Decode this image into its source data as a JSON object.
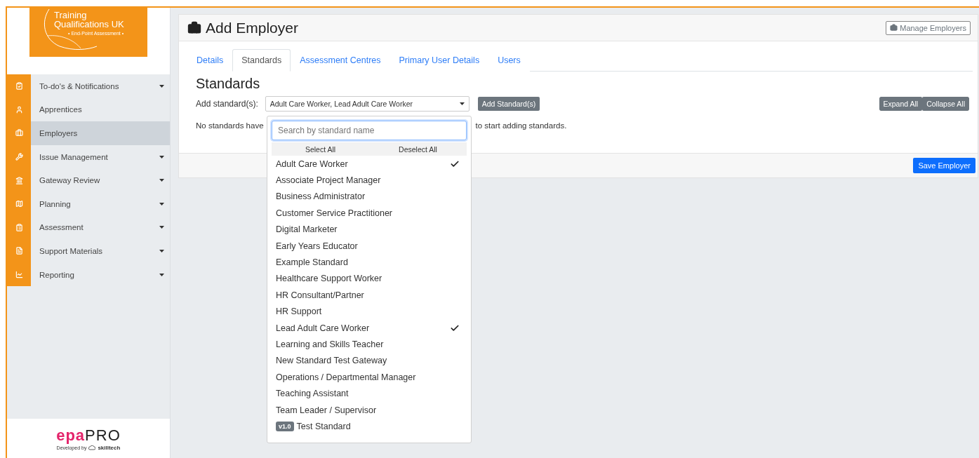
{
  "sidebar": {
    "logo": {
      "line_1": "Training",
      "line_2": "Qualifications UK",
      "tagline": "• End-Point Assessment •"
    },
    "items": [
      {
        "label": "To-do's & Notifications",
        "expandable": true,
        "selected": false
      },
      {
        "label": "Apprentices",
        "expandable": false,
        "selected": false
      },
      {
        "label": "Employers",
        "expandable": false,
        "selected": true
      },
      {
        "label": "Issue Management",
        "expandable": true,
        "selected": false
      },
      {
        "label": "Gateway Review",
        "expandable": true,
        "selected": false
      },
      {
        "label": "Planning",
        "expandable": true,
        "selected": false
      },
      {
        "label": "Assessment",
        "expandable": true,
        "selected": false
      },
      {
        "label": "Support Materials",
        "expandable": true,
        "selected": false
      },
      {
        "label": "Reporting",
        "expandable": true,
        "selected": false
      }
    ],
    "footer": {
      "brand_1": "epa",
      "brand_2": "PRO",
      "developed_by": "Developed by",
      "developer": "skilltech"
    }
  },
  "page": {
    "title": "Add Employer",
    "manage_button": "Manage Employers"
  },
  "tabs": [
    {
      "label": "Details",
      "selected": false
    },
    {
      "label": "Standards",
      "selected": true
    },
    {
      "label": "Assessment Centres",
      "selected": false
    },
    {
      "label": "Primary User Details",
      "selected": false
    },
    {
      "label": "Users",
      "selected": false
    }
  ],
  "section": {
    "title": "Standards",
    "add_label": "Add standard(s):",
    "select_value": "Adult Care Worker, Lead Adult Care Worker",
    "add_button": "Add Standard(s)",
    "expand_button": "Expand All",
    "collapse_button": "Collapse All",
    "empty_message_start": "No standards have",
    "empty_message_end": "to start adding standards."
  },
  "dropdown": {
    "search_placeholder": "Search by standard name",
    "select_all": "Select All",
    "deselect_all": "Deselect All",
    "options": [
      {
        "label": "Adult Care Worker",
        "checked": true
      },
      {
        "label": "Associate Project Manager",
        "checked": false
      },
      {
        "label": "Business Administrator",
        "checked": false
      },
      {
        "label": "Customer Service Practitioner",
        "checked": false
      },
      {
        "label": "Digital Marketer",
        "checked": false
      },
      {
        "label": "Early Years Educator",
        "checked": false
      },
      {
        "label": "Example Standard",
        "checked": false
      },
      {
        "label": "Healthcare Support Worker",
        "checked": false
      },
      {
        "label": "HR Consultant/Partner",
        "checked": false
      },
      {
        "label": "HR Support",
        "checked": false
      },
      {
        "label": "Lead Adult Care Worker",
        "checked": true
      },
      {
        "label": "Learning and Skills Teacher",
        "checked": false
      },
      {
        "label": "New Standard Test Gateway",
        "checked": false
      },
      {
        "label": "Operations / Departmental Manager",
        "checked": false
      },
      {
        "label": "Teaching Assistant",
        "checked": false
      },
      {
        "label": "Team Leader / Supervisor",
        "checked": false
      },
      {
        "label": "Test Standard",
        "checked": false,
        "badge": "v1.0"
      }
    ]
  },
  "save_button": "Save Employer"
}
